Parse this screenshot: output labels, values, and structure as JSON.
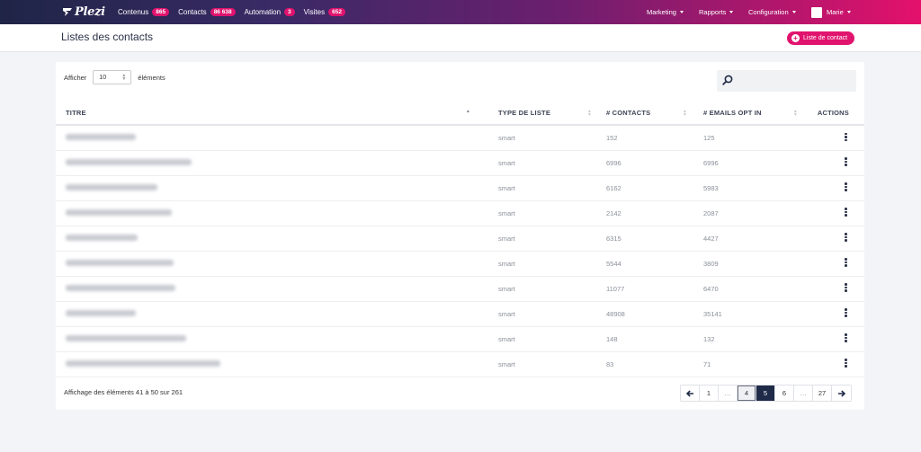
{
  "nav": {
    "logo_text": "Plezi",
    "items": [
      {
        "label": "Contenus",
        "badge": "865"
      },
      {
        "label": "Contacts",
        "badge": "86 638"
      },
      {
        "label": "Automation",
        "badge": "3"
      },
      {
        "label": "Visites",
        "badge": "652"
      }
    ],
    "right": {
      "marketing": "Marketing",
      "rapports": "Rapports",
      "configuration": "Configuration",
      "user": "Marie"
    }
  },
  "header": {
    "title": "Listes des contacts",
    "add_button": "Liste de contact"
  },
  "controls": {
    "show_prefix": "Afficher",
    "page_length": "10",
    "show_suffix": "éléments",
    "search_value": ""
  },
  "table": {
    "columns": {
      "title": "TITRE",
      "type": "TYPE DE LISTE",
      "contacts": "# CONTACTS",
      "optin": "# EMAILS OPT IN",
      "actions": "ACTIONS"
    },
    "rows": [
      {
        "type": "smart",
        "contacts": "152",
        "optin": "125"
      },
      {
        "type": "smart",
        "contacts": "6996",
        "optin": "6996"
      },
      {
        "type": "smart",
        "contacts": "6162",
        "optin": "5983"
      },
      {
        "type": "smart",
        "contacts": "2142",
        "optin": "2087"
      },
      {
        "type": "smart",
        "contacts": "6315",
        "optin": "4427"
      },
      {
        "type": "smart",
        "contacts": "5544",
        "optin": "3809"
      },
      {
        "type": "smart",
        "contacts": "11077",
        "optin": "6470"
      },
      {
        "type": "smart",
        "contacts": "48908",
        "optin": "35141"
      },
      {
        "type": "smart",
        "contacts": "148",
        "optin": "132"
      },
      {
        "type": "smart",
        "contacts": "83",
        "optin": "71"
      }
    ]
  },
  "footer": {
    "info": "Affichage des éléments 41 à 50 sur 261",
    "pages": [
      "1",
      "…",
      "4",
      "5",
      "6",
      "…",
      "27"
    ]
  },
  "colors": {
    "accent": "#e0136e",
    "nav_dark": "#1f2547",
    "active_page": "#1e2a47"
  }
}
